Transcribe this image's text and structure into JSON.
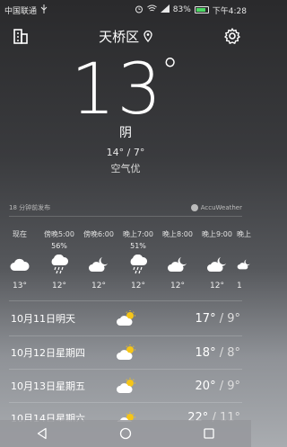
{
  "status_bar": {
    "carrier": "中国联通",
    "carrier_icon": "usb-icon",
    "battery": "83%",
    "time": "下午4:28"
  },
  "header": {
    "city": "天桥区",
    "left_icon": "city-buildings-icon",
    "location_icon": "location-pin-icon",
    "settings_icon": "gear-icon"
  },
  "current": {
    "temperature": "13",
    "degree_symbol": "°",
    "condition": "阴",
    "range": "14° / 7°",
    "air_quality": "空气优"
  },
  "publish": {
    "time_text": "18 分钟前发布",
    "provider": "AccuWeather"
  },
  "hourly": [
    {
      "time": "现在",
      "pop": "",
      "icon": "cloudy-icon",
      "temp": "13°"
    },
    {
      "time": "傍晚5:00",
      "pop": "56%",
      "icon": "rain-cloud-icon",
      "temp": "12°"
    },
    {
      "time": "傍晚6:00",
      "pop": "",
      "icon": "cloud-moon-icon",
      "temp": "12°"
    },
    {
      "time": "晚上7:00",
      "pop": "51%",
      "icon": "rain-cloud-icon",
      "temp": "12°"
    },
    {
      "time": "晚上8:00",
      "pop": "",
      "icon": "cloud-moon-icon",
      "temp": "12°"
    },
    {
      "time": "晚上9:00",
      "pop": "",
      "icon": "cloud-moon-icon",
      "temp": "12°"
    },
    {
      "time": "晚上",
      "pop": "",
      "icon": "cloud-moon-icon",
      "temp": "1"
    }
  ],
  "daily": [
    {
      "day": "10月11日明天",
      "icon": "partly-sunny-icon",
      "high": "17°",
      "low": " / 9°"
    },
    {
      "day": "10月12日星期四",
      "icon": "partly-sunny-icon",
      "high": "18°",
      "low": " / 8°"
    },
    {
      "day": "10月13日星期五",
      "icon": "partly-sunny-icon",
      "high": "20°",
      "low": " / 9°"
    },
    {
      "day": "10月14日星期六",
      "icon": "partly-sunny-icon",
      "high": "22°",
      "low": " / 11°"
    }
  ],
  "nav": {
    "back_icon": "back-triangle-icon",
    "home_icon": "home-circle-icon",
    "recents_icon": "recents-square-icon"
  },
  "colors": {
    "accent": "#ffffff",
    "sun": "#f5c518"
  }
}
